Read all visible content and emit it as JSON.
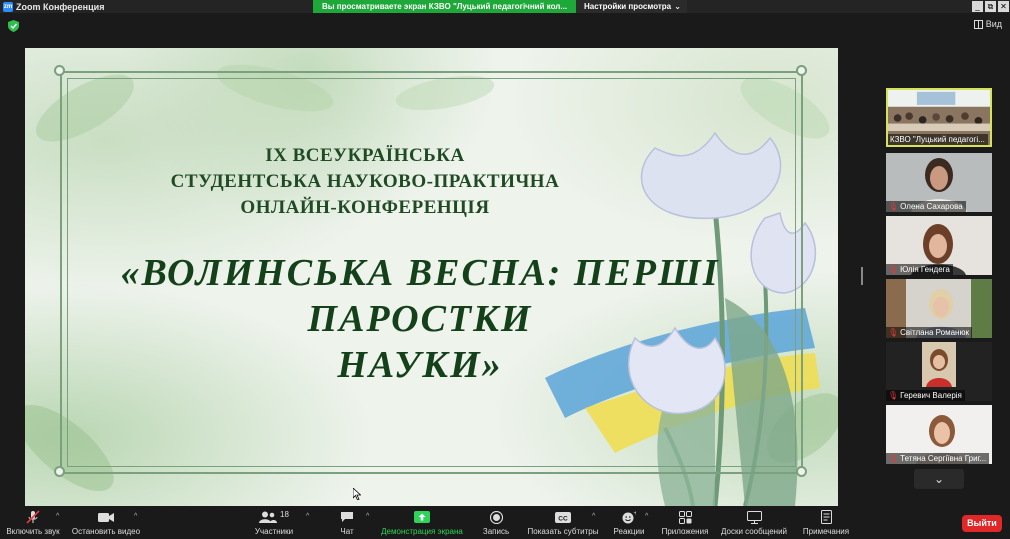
{
  "titlebar": {
    "app_icon": "zm",
    "title": "Zoom Конференция",
    "share_banner": "Вы просматриваете экран КЗВО \"Луцький педагогічний кол...",
    "view_options": "Настройки просмотра",
    "window_controls": [
      "_",
      "⧉",
      "✕"
    ]
  },
  "topbar": {
    "view_label": "Вид"
  },
  "slide": {
    "heading_lines": [
      "IX ВСЕУКРАЇНСЬКА",
      "СТУДЕНТСЬКА НАУКОВО-ПРАКТИЧНА",
      "ОНЛАЙН-КОНФЕРЕНЦІЯ"
    ],
    "title_lines": [
      "«ВОЛИНСЬКА ВЕСНА: ПЕРШІ",
      "ПАРОСТКИ",
      "НАУКИ»"
    ]
  },
  "participants": [
    {
      "name": "КЗВО \"Луцький педагогі...",
      "muted": false,
      "active": true
    },
    {
      "name": "Олена Сахарова",
      "muted": true,
      "active": false
    },
    {
      "name": "Юлія Гендега",
      "muted": true,
      "active": false
    },
    {
      "name": "Світлана Романюк",
      "muted": true,
      "active": false
    },
    {
      "name": "Геревич Валерія",
      "muted": true,
      "active": false
    },
    {
      "name": "Тетяна Сергіївна Григ...",
      "muted": true,
      "active": false
    }
  ],
  "toolbar": {
    "unmute": "Включить звук",
    "stop_video": "Остановить видео",
    "participants": "Участники",
    "participants_count": "18",
    "chat": "Чат",
    "share_screen": "Демонстрация экрана",
    "record": "Запись",
    "captions": "Показать субтитры",
    "reactions": "Реакции",
    "apps": "Приложения",
    "whiteboards": "Доски сообщений",
    "notes": "Примечания",
    "leave": "Выйти"
  },
  "colors": {
    "share_banner": "#1fa83a",
    "active_speaker_border": "#d6e25a",
    "leave_button": "#e02828",
    "slide_text": "#1f4a24"
  }
}
